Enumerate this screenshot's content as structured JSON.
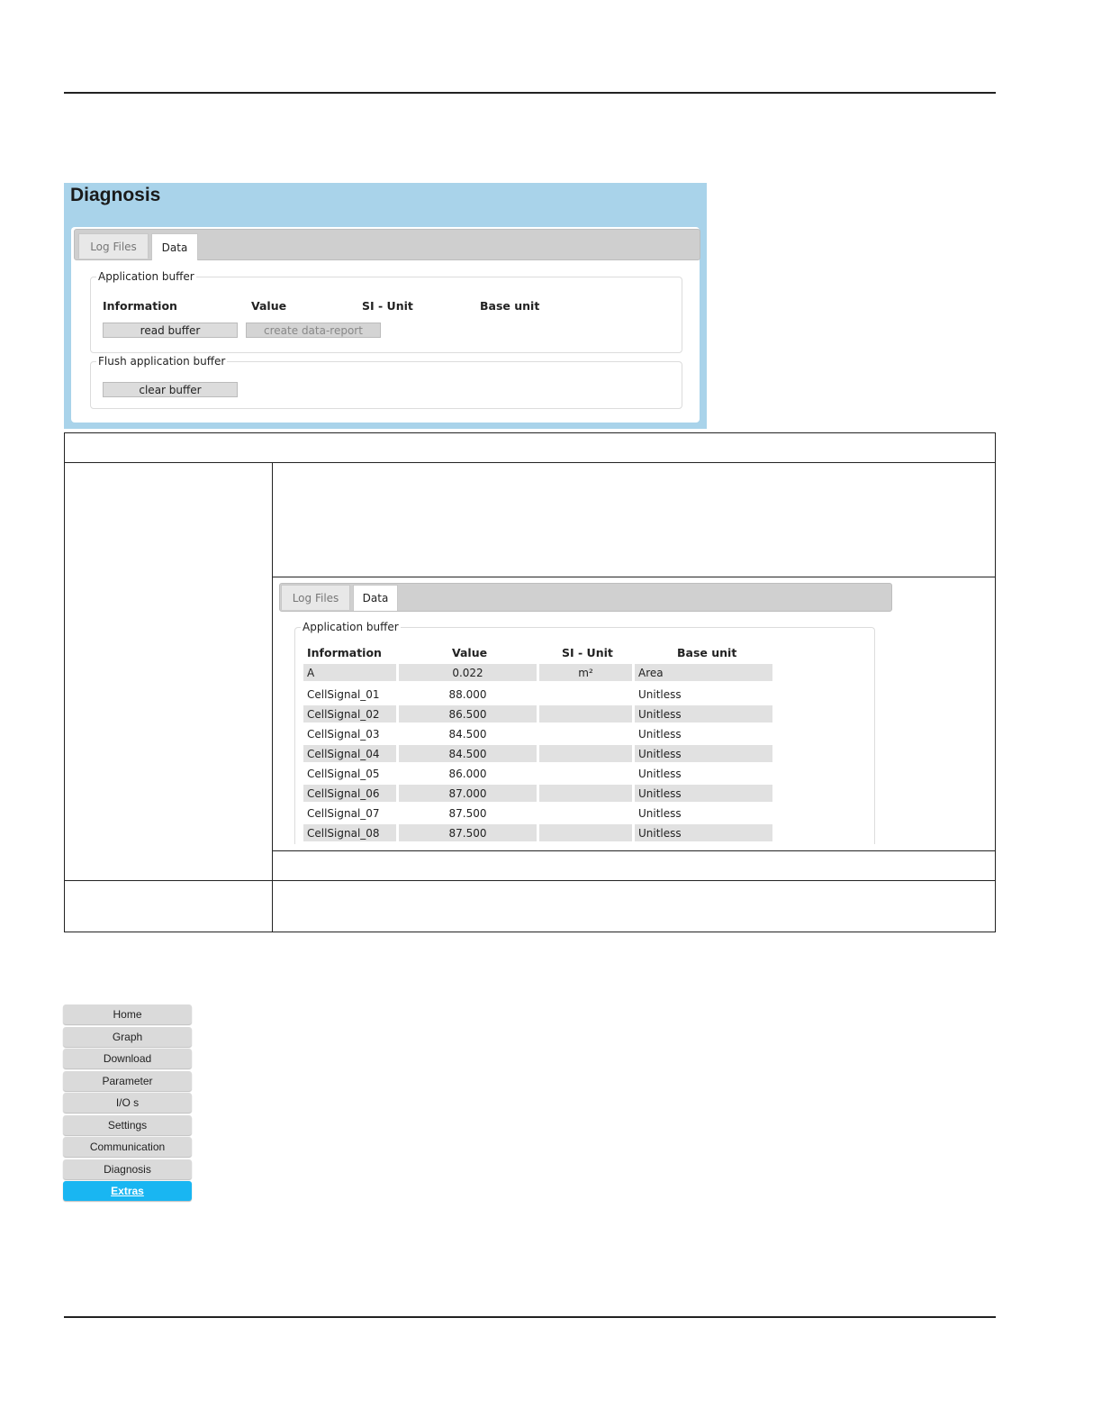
{
  "diagnosis": {
    "title": "Diagnosis",
    "tabs": [
      "Log Files",
      "Data"
    ],
    "application_buffer": {
      "legend": "Application buffer",
      "headers": [
        "Information",
        "Value",
        "SI - Unit",
        "Base unit"
      ],
      "read_button": "read buffer",
      "report_button": "create data-report"
    },
    "flush_buffer": {
      "legend": "Flush application buffer",
      "clear_button": "clear buffer"
    }
  },
  "data_view": {
    "tabs": [
      "Log Files",
      "Data"
    ],
    "legend": "Application buffer",
    "headers": [
      "Information",
      "Value",
      "SI - Unit",
      "Base unit"
    ],
    "rows": [
      {
        "info": "A",
        "value": "0.022",
        "si": "m²",
        "base": "Area"
      },
      {
        "info": "CellSignal_01",
        "value": "88.000",
        "si": "",
        "base": "Unitless"
      },
      {
        "info": "CellSignal_02",
        "value": "86.500",
        "si": "",
        "base": "Unitless"
      },
      {
        "info": "CellSignal_03",
        "value": "84.500",
        "si": "",
        "base": "Unitless"
      },
      {
        "info": "CellSignal_04",
        "value": "84.500",
        "si": "",
        "base": "Unitless"
      },
      {
        "info": "CellSignal_05",
        "value": "86.000",
        "si": "",
        "base": "Unitless"
      },
      {
        "info": "CellSignal_06",
        "value": "87.000",
        "si": "",
        "base": "Unitless"
      },
      {
        "info": "CellSignal_07",
        "value": "87.500",
        "si": "",
        "base": "Unitless"
      },
      {
        "info": "CellSignal_08",
        "value": "87.500",
        "si": "",
        "base": "Unitless"
      }
    ]
  },
  "nav": {
    "items": [
      "Home",
      "Graph",
      "Download",
      "Parameter",
      "I/O s",
      "Settings",
      "Communication",
      "Diagnosis",
      "Extras"
    ],
    "active": "Extras"
  },
  "colors": {
    "panel_bg": "#a9d3ea",
    "nav_active": "#19b6f2",
    "row_shade": "#e1e1e1"
  }
}
